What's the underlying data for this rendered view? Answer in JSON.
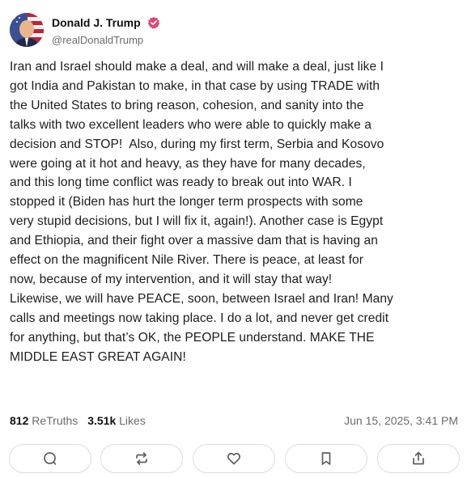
{
  "author": {
    "name": "Donald J. Trump",
    "handle": "@realDonaldTrump",
    "verified": true,
    "verified_color": "#e0457b"
  },
  "post": {
    "text": "Iran and Israel should make a deal, and will make a deal, just like I\ngot India and Pakistan to make, in that case by using TRADE with\nthe United States to bring reason, cohesion, and sanity into the\ntalks with two excellent leaders who were able to quickly make a\ndecision and STOP!  Also, during my first term, Serbia and Kosovo\nwere going at it hot and heavy, as they have for many decades,\nand this long time conflict was ready to break out into WAR. I\nstopped it (Biden has hurt the longer term prospects with some\nvery stupid decisions, but I will fix it, again!). Another case is Egypt\nand Ethiopia, and their fight over a massive dam that is having an\neffect on the magnificent Nile River. There is peace, at least for\nnow, because of my intervention, and it will stay that way!\nLikewise, we will have PEACE, soon, between Israel and Iran! Many\ncalls and meetings now taking place. I do a lot, and never get credit\nfor anything, but that’s OK, the PEOPLE understand. MAKE THE\nMIDDLE EAST GREAT AGAIN!"
  },
  "stats": {
    "retruths_count": "812",
    "retruths_label": "ReTruths",
    "likes_count": "3.51k",
    "likes_label": "Likes",
    "timestamp": "Jun 15, 2025, 3:41 PM"
  },
  "actions": [
    {
      "icon": "reply-icon"
    },
    {
      "icon": "retruth-icon"
    },
    {
      "icon": "heart-icon"
    },
    {
      "icon": "bookmark-icon"
    },
    {
      "icon": "share-icon"
    }
  ],
  "colors": {
    "text": "#1d1d1d",
    "muted": "#6b6b6b",
    "border": "#dcdcdc",
    "icon": "#5f5f5f"
  }
}
